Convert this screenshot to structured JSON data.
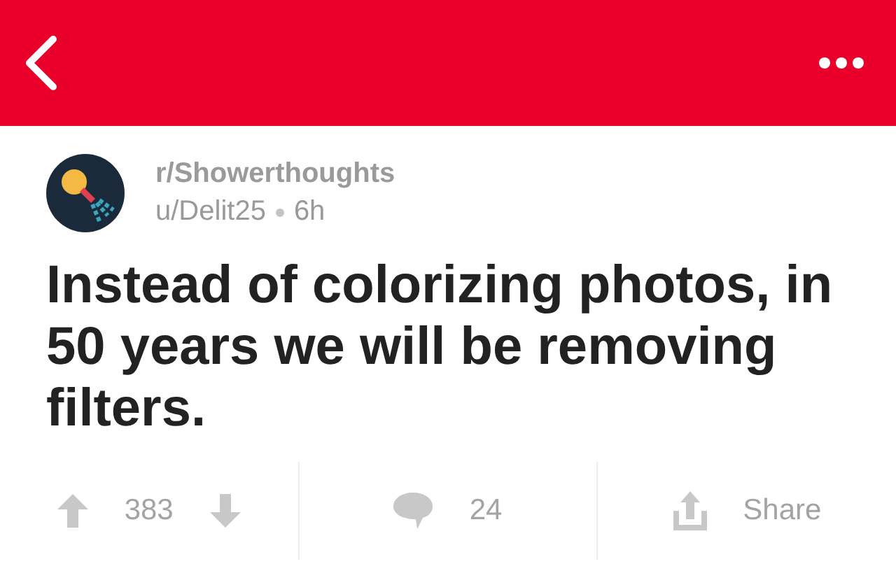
{
  "post": {
    "subreddit": "r/Showerthoughts",
    "author": "u/Delit25",
    "time": "6h",
    "title": "Instead of colorizing photos, in 50 years we will be removing filters."
  },
  "actions": {
    "score": "383",
    "comments": "24",
    "share": "Share"
  }
}
